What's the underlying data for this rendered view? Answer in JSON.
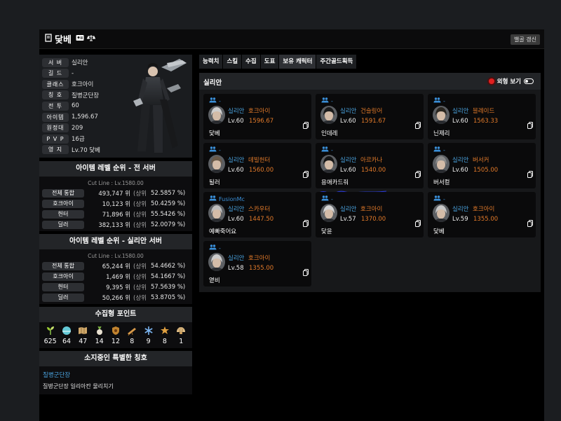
{
  "header": {
    "name": "닻베",
    "refresh_label": "밸골 갱신"
  },
  "profile": {
    "rows": [
      {
        "label": "서 버",
        "value": "실리안"
      },
      {
        "label": "길 드",
        "value": "-"
      },
      {
        "label": "클래스",
        "value": "호크아이"
      },
      {
        "label": "칭 호",
        "value": "질병군단장"
      },
      {
        "label": "전 투",
        "value": "60"
      },
      {
        "label": "아이템",
        "value": "1,596.67"
      },
      {
        "label": "원정대",
        "value": "209"
      },
      {
        "label": "P V P",
        "value": "16급"
      },
      {
        "label": "영 지",
        "value": "Lv.70 닻베"
      }
    ]
  },
  "rank_all": {
    "title": "아이템 레벨 순위 - 전 서버",
    "cutline": "Cut Line : Lv.1580.00",
    "sub_label": "(상위",
    "rows": [
      {
        "label": "전체 통합",
        "rank": "493,747 위",
        "pct": "52.5857 %)"
      },
      {
        "label": "호크아이",
        "rank": "10,123 위",
        "pct": "50.4259 %)"
      },
      {
        "label": "헌터",
        "rank": "71,896 위",
        "pct": "55.5426 %)"
      },
      {
        "label": "딜러",
        "rank": "382,133 위",
        "pct": "52.0079 %)"
      }
    ]
  },
  "rank_server": {
    "title": "아이템 레벨 순위 - 실리안 서버",
    "cutline": "Cut Line : Lv.1580.00",
    "sub_label": "(상위",
    "rows": [
      {
        "label": "전체 통합",
        "rank": "65,244 위",
        "pct": "54.4662 %)"
      },
      {
        "label": "호크아이",
        "rank": "1,469 위",
        "pct": "54.1667 %)"
      },
      {
        "label": "헌터",
        "rank": "9,395 위",
        "pct": "57.5639 %)"
      },
      {
        "label": "딜러",
        "rank": "50,266 위",
        "pct": "53.8705 %)"
      }
    ]
  },
  "collection": {
    "title": "수집형 포인트",
    "items": [
      {
        "icon": "sprout-icon",
        "count": "625"
      },
      {
        "icon": "island-heart-icon",
        "count": "64"
      },
      {
        "icon": "map-icon",
        "count": "47"
      },
      {
        "icon": "mokoko-icon",
        "count": "14"
      },
      {
        "icon": "shield-icon",
        "count": "12"
      },
      {
        "icon": "telescope-icon",
        "count": "8"
      },
      {
        "icon": "snowflake-icon",
        "count": "9"
      },
      {
        "icon": "star-icon",
        "count": "8"
      },
      {
        "icon": "shell-icon",
        "count": "1"
      }
    ]
  },
  "titles": {
    "title": "소지중인 특별한 칭호",
    "name": "질병군단장",
    "desc": "질병군단장 일리아칸 물리치기"
  },
  "tabs": [
    "능력치",
    "스킬",
    "수집",
    "도표",
    "보유 캐릭터",
    "주간골드획득"
  ],
  "active_tab": 4,
  "roster": {
    "server_title": "실리안",
    "look_label": "외형 보기",
    "characters": [
      {
        "guild": "-",
        "server": "실리안",
        "class": "호크아이",
        "level": "Lv.60",
        "item_level": "1596.67",
        "name": "닻베",
        "hair": "#cfcfcf"
      },
      {
        "guild": "-",
        "server": "실리안",
        "class": "건슬링어",
        "level": "Lv.60",
        "item_level": "1591.67",
        "name": "인데레",
        "hair": "#1a1a1a"
      },
      {
        "guild": "-",
        "server": "실리안",
        "class": "블레이드",
        "level": "Lv.60",
        "item_level": "1563.33",
        "name": "닌제리",
        "hair": "#2a2620"
      },
      {
        "guild": "-",
        "server": "실리안",
        "class": "데빌헌터",
        "level": "Lv.60",
        "item_level": "1560.00",
        "name": "될러",
        "hair": "#6a5a4a"
      },
      {
        "guild": "-",
        "server": "실리안",
        "class": "아르카나",
        "level": "Lv.60",
        "item_level": "1540.00",
        "name": "용애카드줘",
        "hair": "#151515"
      },
      {
        "guild": "-",
        "server": "실리안",
        "class": "버서커",
        "level": "Lv.60",
        "item_level": "1505.00",
        "name": "버서컬",
        "hair": "#8a8a8a"
      },
      {
        "guild": "FusionMc",
        "server": "실리안",
        "class": "스카우터",
        "level": "Lv.60",
        "item_level": "1447.50",
        "name": "예빠죽어요",
        "hair": "#bdbdbd"
      },
      {
        "guild": "-",
        "server": "실리안",
        "class": "호크아이",
        "level": "Lv.57",
        "item_level": "1370.00",
        "name": "닻윤",
        "hair": "#d5d5d5"
      },
      {
        "guild": "-",
        "server": "실리안",
        "class": "호크아이",
        "level": "Lv.59",
        "item_level": "1355.00",
        "name": "닻베",
        "hair": "#c8c8c8"
      },
      {
        "guild": "-",
        "server": "실리안",
        "class": "호크아이",
        "level": "Lv.58",
        "item_level": "1355.00",
        "name": "옅비",
        "hair": "#cccccc"
      }
    ]
  },
  "colors": {
    "accent_blue": "#4aa3df",
    "accent_orange": "#e27a2a",
    "radio_red": "#e02020"
  }
}
